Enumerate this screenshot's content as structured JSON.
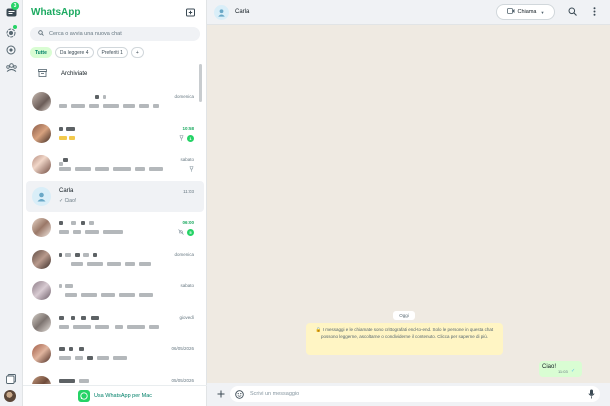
{
  "app_title": "WhatsApp",
  "rail": {
    "badge": "3"
  },
  "search": {
    "placeholder": "Cerca o avvia una nuova chat"
  },
  "filters": [
    "Tutte",
    "Da leggere 4",
    "Preferiti 1",
    "+"
  ],
  "archived_label": "Archiviate",
  "chats": [
    {
      "name": "",
      "msg": "",
      "time": "domenica"
    },
    {
      "name": "",
      "msg": "",
      "time": "10:58",
      "unread": "1",
      "pinned": true
    },
    {
      "name": "",
      "msg": "",
      "time": "sabato",
      "pinned": true
    },
    {
      "name": "Carla",
      "msg": "✓ Ciao!",
      "time": "11:03",
      "selected": true
    },
    {
      "name": "",
      "msg": "",
      "time": "06:00",
      "unread": "5",
      "muted": true
    },
    {
      "name": "",
      "msg": "",
      "time": "domenica"
    },
    {
      "name": "",
      "msg": "",
      "time": "sabato"
    },
    {
      "name": "",
      "msg": "",
      "time": "giovedì"
    },
    {
      "name": "",
      "msg": "",
      "time": "06/05/2026"
    },
    {
      "name": "",
      "msg": "",
      "time": "05/05/2026"
    }
  ],
  "footer": {
    "label": "Usa WhatsApp per Mac"
  },
  "conversation": {
    "contact": "Carla",
    "call_label": "Chiama",
    "date_pill": "Oggi",
    "system_msg": "🔒 I messaggi e le chiamate sono crittografati end-to-end. Solo le persone in questa chat possono leggerne, ascoltarne o condividerne il contenuto. Clicca per saperne di più.",
    "bubble": {
      "text": "Ciao!",
      "time": "11:03",
      "status": "✓"
    },
    "compose_placeholder": "Scrivi un messaggio"
  },
  "icons": {
    "rail": [
      "chats-icon",
      "status-icon",
      "channels-icon",
      "communities-icon",
      "media-icon"
    ],
    "header": [
      "new-chat-icon",
      "menu-icon"
    ],
    "pane": [
      "video-icon",
      "search-icon",
      "menu-icon"
    ],
    "compose": [
      "plus-icon",
      "sticker-icon",
      "mic-icon"
    ]
  },
  "colors": {
    "brand": "#1daa61",
    "bubble": "#d9fdd3",
    "system_bg": "#fff5c4"
  }
}
